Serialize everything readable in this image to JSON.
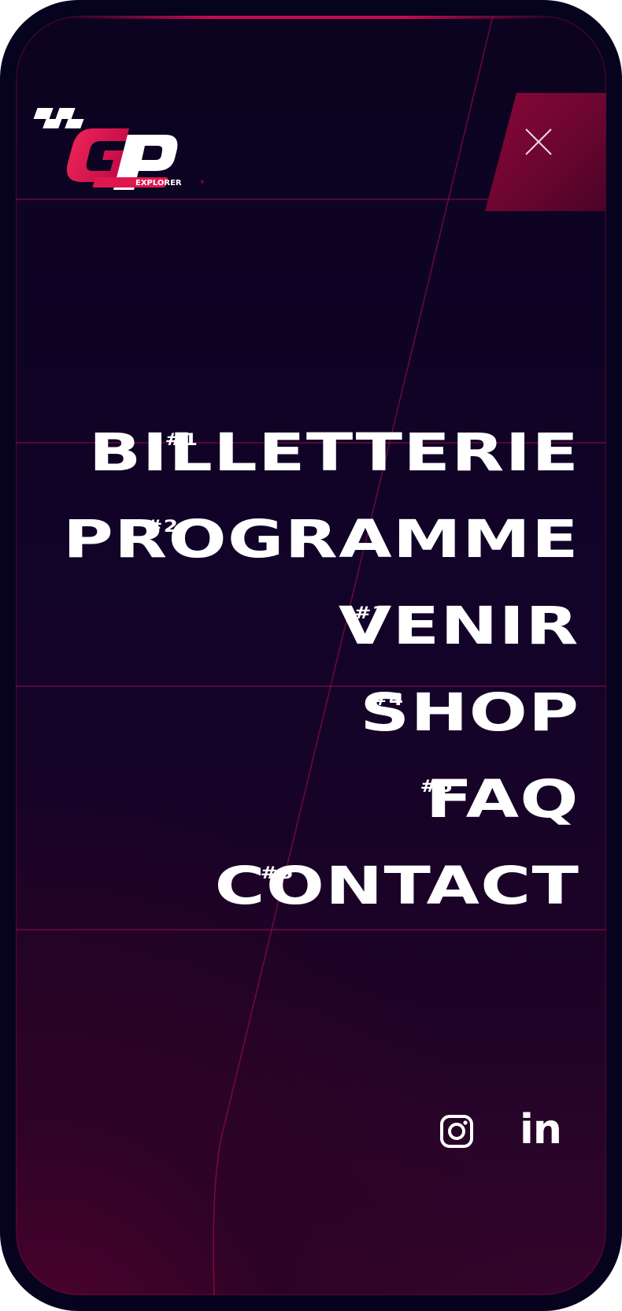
{
  "brand": {
    "logo_letters": "GP",
    "logo_tag": "EXPLORER",
    "accent": "#e0174f",
    "background": "#0b0320"
  },
  "header": {
    "close_icon": "close-icon"
  },
  "nav": {
    "items": [
      {
        "num": "#1",
        "label": "BILLETTERIE"
      },
      {
        "num": "#2",
        "label": "PROGRAMME"
      },
      {
        "num": "#3",
        "label": "VENIR"
      },
      {
        "num": "#4",
        "label": "SHOP"
      },
      {
        "num": "#5",
        "label": "FAQ"
      },
      {
        "num": "#6",
        "label": "CONTACT"
      }
    ]
  },
  "social": {
    "instagram_icon": "instagram-icon",
    "linkedin_label": "in"
  }
}
